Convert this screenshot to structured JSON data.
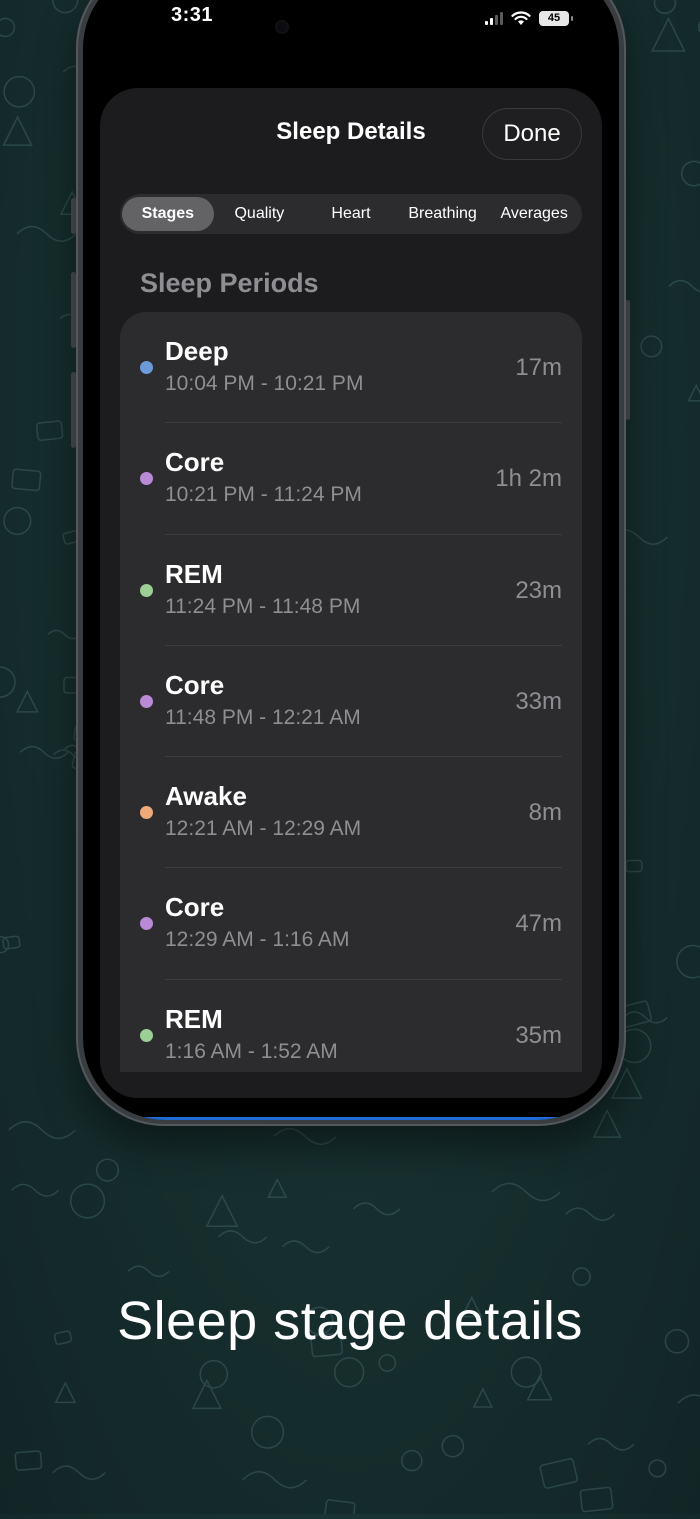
{
  "status_bar": {
    "time": "3:31",
    "battery": "45"
  },
  "header": {
    "title": "Sleep Details",
    "done_label": "Done"
  },
  "tabs": [
    {
      "label": "Stages",
      "active": true
    },
    {
      "label": "Quality",
      "active": false
    },
    {
      "label": "Heart",
      "active": false
    },
    {
      "label": "Breathing",
      "active": false
    },
    {
      "label": "Averages",
      "active": false
    }
  ],
  "section_title": "Sleep Periods",
  "periods": [
    {
      "stage": "Deep",
      "range": "10:04 PM - 10:21 PM",
      "duration": "17m",
      "color": "#6b9bd8"
    },
    {
      "stage": "Core",
      "range": "10:21 PM - 11:24 PM",
      "duration": "1h 2m",
      "color": "#b98ad6"
    },
    {
      "stage": "REM",
      "range": "11:24 PM - 11:48 PM",
      "duration": "23m",
      "color": "#9ccf95"
    },
    {
      "stage": "Core",
      "range": "11:48 PM - 12:21 AM",
      "duration": "33m",
      "color": "#b98ad6"
    },
    {
      "stage": "Awake",
      "range": "12:21 AM - 12:29 AM",
      "duration": "8m",
      "color": "#f0a97a"
    },
    {
      "stage": "Core",
      "range": "12:29 AM - 1:16 AM",
      "duration": "47m",
      "color": "#b98ad6"
    },
    {
      "stage": "REM",
      "range": "1:16 AM - 1:52 AM",
      "duration": "35m",
      "color": "#9ccf95"
    }
  ],
  "caption": "Sleep stage details"
}
